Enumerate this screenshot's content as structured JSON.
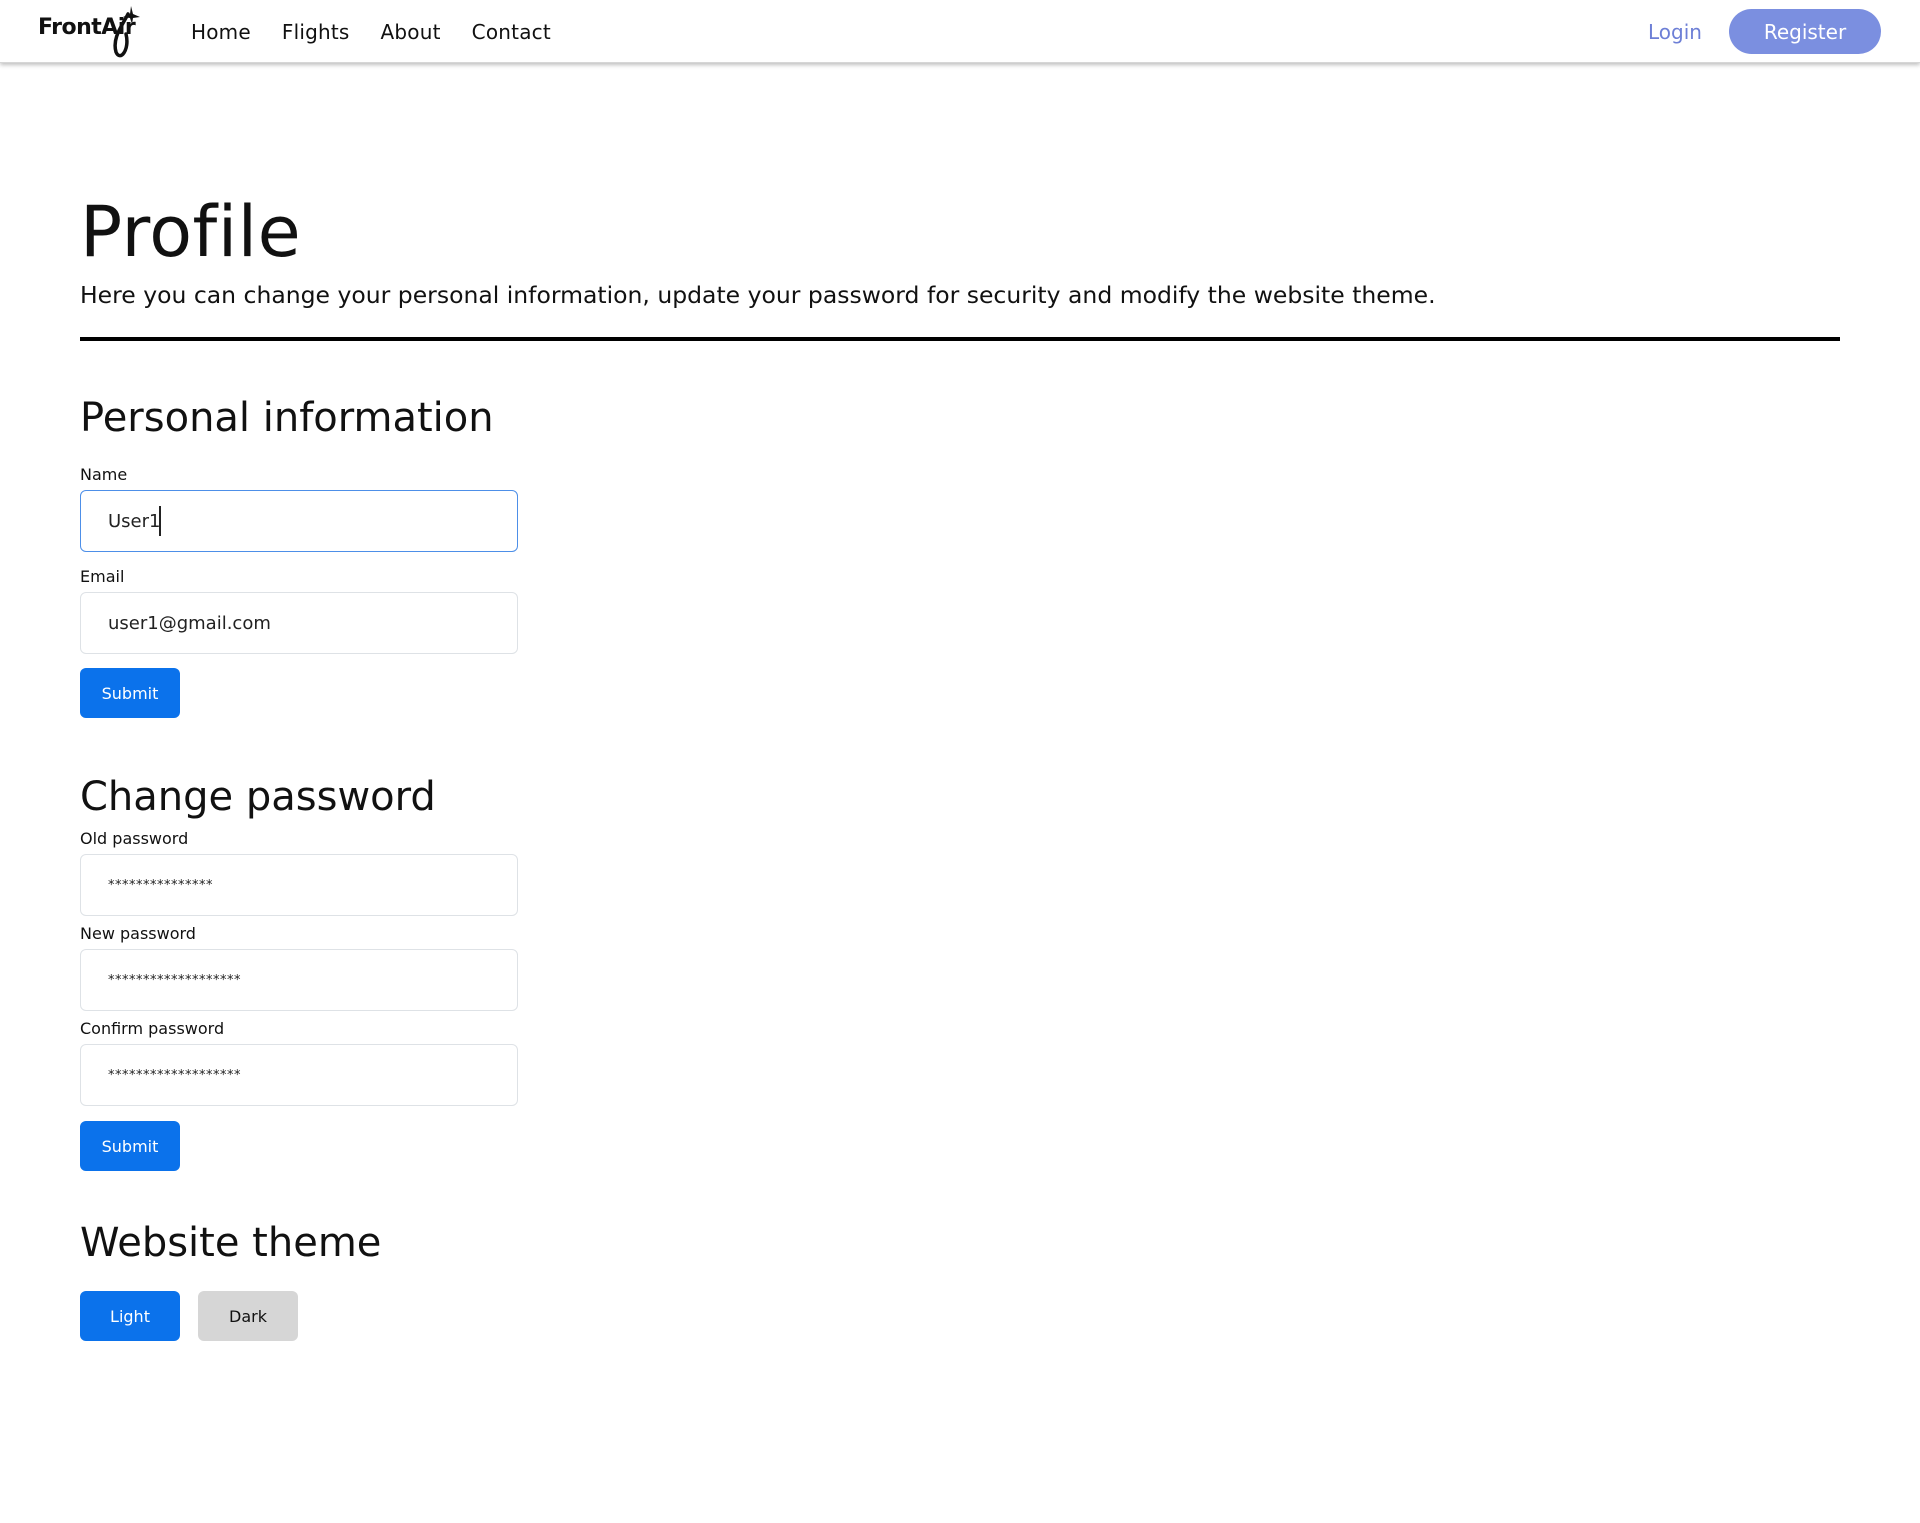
{
  "navbar": {
    "logo_text": "FrontAir",
    "links": [
      "Home",
      "Flights",
      "About",
      "Contact"
    ],
    "login_label": "Login",
    "register_label": "Register"
  },
  "page": {
    "title": "Profile",
    "intro": "Here you can change your personal information, update your password for security and modify the website theme."
  },
  "personal_info": {
    "title": "Personal information",
    "name_label": "Name",
    "name_value": "User1",
    "email_label": "Email",
    "email_value": "user1@gmail.com",
    "submit_label": "Submit"
  },
  "change_password": {
    "title": "Change password",
    "old_label": "Old password",
    "old_value": "***************",
    "new_label": "New password",
    "new_value": "*******************",
    "confirm_label": "Confirm password",
    "confirm_value": "*******************",
    "submit_label": "Submit"
  },
  "theme": {
    "title": "Website theme",
    "light_label": "Light",
    "dark_label": "Dark"
  },
  "colors": {
    "primary": "#0b72eb",
    "register": "#7b8fe0",
    "login_link": "#6d7fd6",
    "secondary_button": "#d6d6d6",
    "focus_border": "#4d8fe8"
  }
}
